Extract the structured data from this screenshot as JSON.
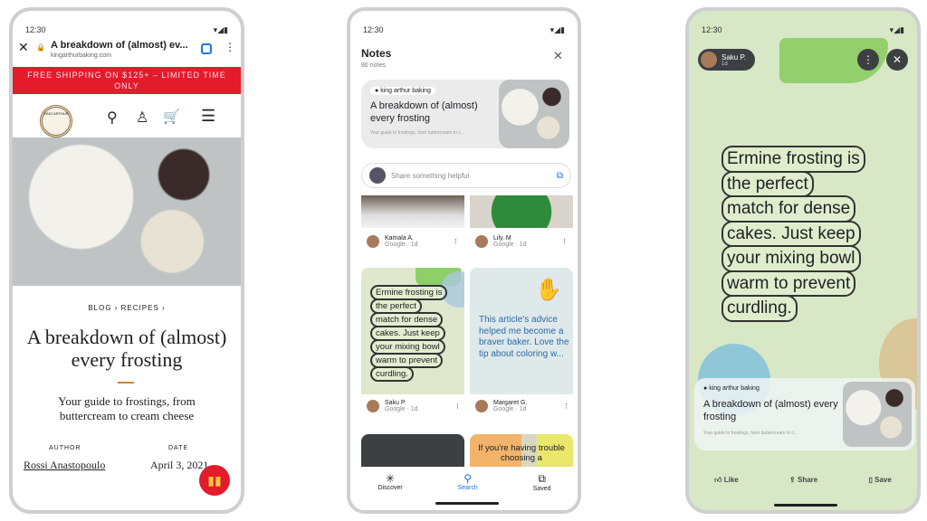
{
  "status_time": "12:30",
  "browser": {
    "page_title": "A breakdown of (almost) ev...",
    "url": "kingarthurbaking.com",
    "banner": "FREE SHIPPING ON $125+ – LIMITED TIME ONLY",
    "logo_text": "KING ARTHUR",
    "breadcrumb": "BLOG › RECIPES ›",
    "title": "A breakdown of (almost) every frosting",
    "subtitle": "Your guide to frostings, from buttercream to cream cheese",
    "author_label": "AUTHOR",
    "author": "Rossi Anastopoulo",
    "date_label": "DATE",
    "date": "April 3, 2021"
  },
  "notes": {
    "title": "Notes",
    "count": "80 notes",
    "source": "king arthur baking",
    "card_title": "A breakdown of (almost) every frosting",
    "card_desc": "Your guide to frostings, from buttercream to c...",
    "share_placeholder": "Share something helpful",
    "items": [
      {
        "name": "Kamala A.",
        "meta": "Google · 1d"
      },
      {
        "name": "Lily. M",
        "meta": "Google · 1d"
      },
      {
        "name": "Saku P.",
        "meta": "Google · 1d"
      },
      {
        "name": "Margaret G.",
        "meta": "Google · 1d"
      }
    ],
    "note1": [
      "Ermine frosting is",
      "the perfect",
      "match for dense",
      "cakes. Just keep",
      "your mixing bowl",
      "warm to prevent",
      "curdling."
    ],
    "note2": "This article's advice helped me become a braver baker. Love the tip about coloring w...",
    "note3": "If you're having trouble choosing a",
    "nav": [
      "Discover",
      "Search",
      "Saved"
    ]
  },
  "detail": {
    "user": "Saku P.",
    "user_meta": "1d",
    "quote": [
      "Ermine frosting is",
      "the perfect",
      "match for dense",
      "cakes. Just keep",
      "your mixing bowl",
      "warm to prevent",
      "curdling."
    ],
    "source": "king arthur baking",
    "card_title": "A breakdown of (almost) every frosting",
    "card_desc": "Your guide to frostings, from buttercream to c...",
    "actions": [
      "Like",
      "Share",
      "Save"
    ]
  },
  "colors": {
    "banner": "#e31b2b",
    "accent": "#1a73e8",
    "green_bg": "#d8e8c6"
  }
}
